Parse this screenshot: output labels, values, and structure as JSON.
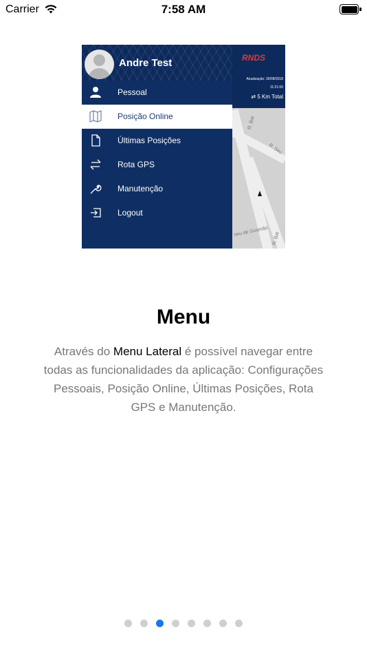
{
  "status_bar": {
    "carrier": "Carrier",
    "time": "7:58 AM",
    "icons": [
      "wifi-icon",
      "battery-icon"
    ]
  },
  "illustration": {
    "user_name": "Andre Test",
    "menu_items": [
      {
        "label": "Pessoal",
        "icon": "person-icon"
      },
      {
        "label": "Posição Online",
        "icon": "map-icon",
        "active": true
      },
      {
        "label": "Últimas Posições",
        "icon": "document-icon"
      },
      {
        "label": "Rota GPS",
        "icon": "arrows-icon"
      },
      {
        "label": "Manutenção",
        "icon": "wrench-icon"
      },
      {
        "label": "Logout",
        "icon": "logout-icon"
      }
    ],
    "map": {
      "logo": "RNDS",
      "update_text": "Atualização: 30/08/2018",
      "time_text": "11:21:00",
      "km_text": "5 Km Total",
      "streets": [
        "R. Bat",
        "R. Seu",
        "neu de Guamão",
        "R. Bat"
      ]
    }
  },
  "content": {
    "title": "Menu",
    "description_before": "Através do ",
    "description_bold": "Menu Lateral",
    "description_after": " é possível navegar entre todas as funcionalidades da aplicação: Configurações Pessoais, Posição Online, Últimas Posições, Rota GPS e Manutenção."
  },
  "pagination": {
    "total": 8,
    "current_index": 2
  },
  "colors": {
    "drawer": "#0f2f64",
    "active_dot": "#1a78e6",
    "inactive_dot": "#cfcfcf"
  }
}
